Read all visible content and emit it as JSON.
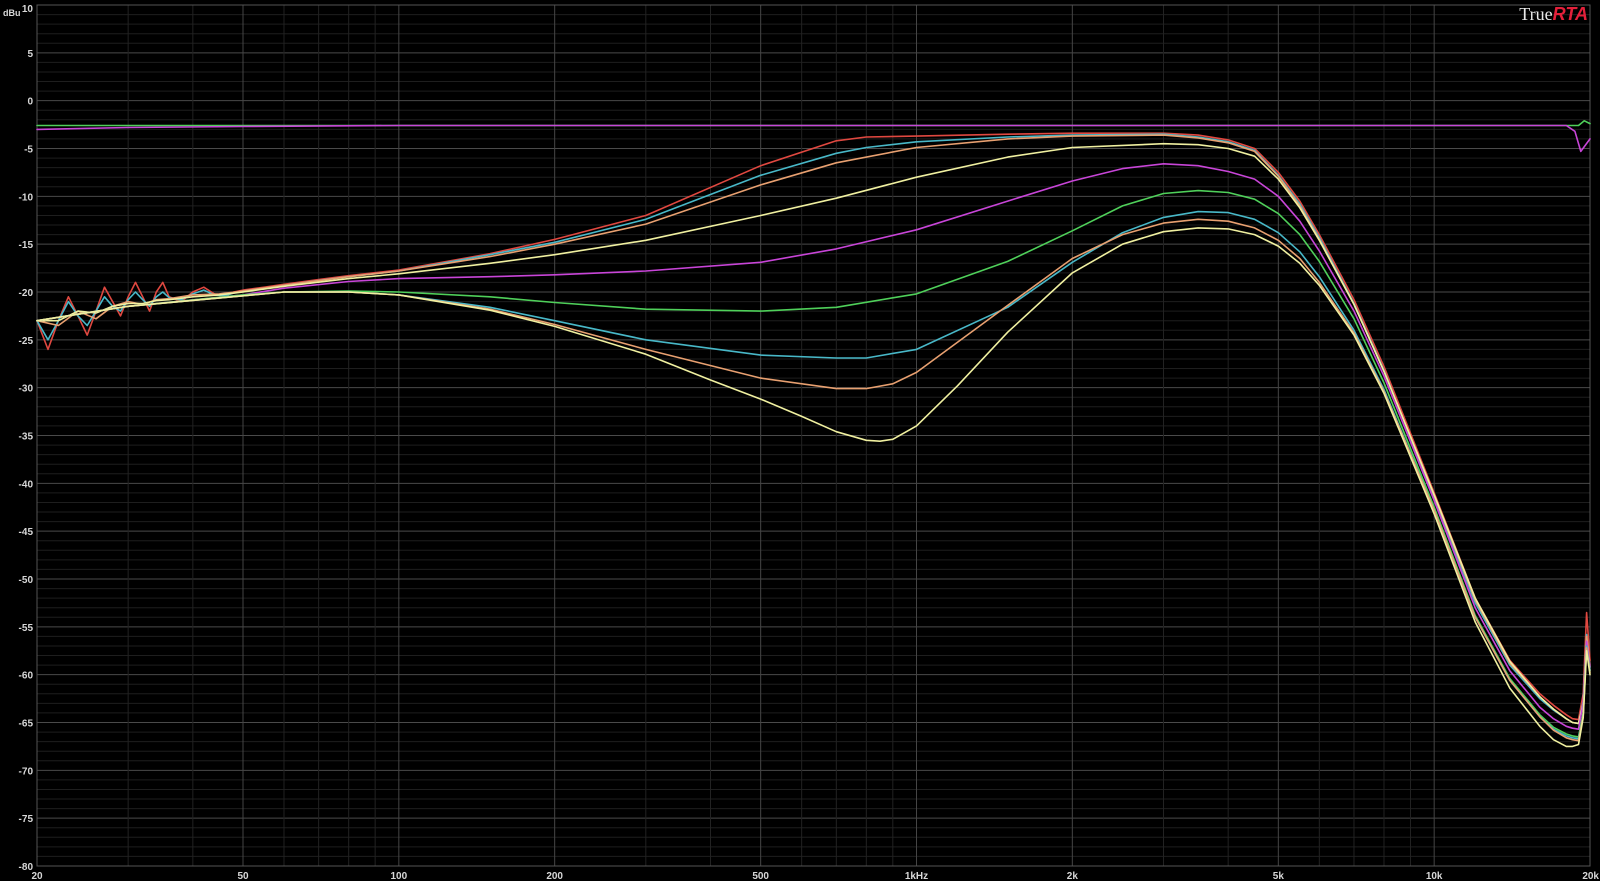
{
  "app": {
    "logo_part1": "True",
    "logo_part2": "RTA"
  },
  "chart_data": {
    "type": "line",
    "title": "",
    "xlabel": "",
    "ylabel": "dBu",
    "xscale": "log",
    "xlim": [
      20,
      20000
    ],
    "ylim": [
      -80,
      10
    ],
    "grid": true,
    "x_tick_labels": [
      {
        "x": 20,
        "label": "20"
      },
      {
        "x": 50,
        "label": "50"
      },
      {
        "x": 100,
        "label": "100"
      },
      {
        "x": 200,
        "label": "200"
      },
      {
        "x": 500,
        "label": "500"
      },
      {
        "x": 1000,
        "label": "1kHz"
      },
      {
        "x": 2000,
        "label": "2k"
      },
      {
        "x": 5000,
        "label": "5k"
      },
      {
        "x": 10000,
        "label": "10k"
      },
      {
        "x": 20000,
        "label": "20k"
      }
    ],
    "y_tick_labels": [
      {
        "y": 10,
        "label": "10"
      },
      {
        "y": 5,
        "label": "5"
      },
      {
        "y": 0,
        "label": "0"
      },
      {
        "y": -5,
        "label": "-5"
      },
      {
        "y": -10,
        "label": "-10"
      },
      {
        "y": -15,
        "label": "-15"
      },
      {
        "y": -20,
        "label": "-20"
      },
      {
        "y": -25,
        "label": "-25"
      },
      {
        "y": -30,
        "label": "-30"
      },
      {
        "y": -35,
        "label": "-35"
      },
      {
        "y": -40,
        "label": "-40"
      },
      {
        "y": -45,
        "label": "-45"
      },
      {
        "y": -50,
        "label": "-50"
      },
      {
        "y": -55,
        "label": "-55"
      },
      {
        "y": -60,
        "label": "-60"
      },
      {
        "y": -65,
        "label": "-65"
      },
      {
        "y": -70,
        "label": "-70"
      },
      {
        "y": -75,
        "label": "-75"
      },
      {
        "y": -80,
        "label": "-80"
      }
    ],
    "series": [
      {
        "color": "#4fd05a",
        "x": [
          20,
          30,
          50,
          100,
          1000,
          5000,
          10000,
          18000,
          19000,
          19500,
          20000
        ],
        "y": [
          -2.6,
          -2.6,
          -2.6,
          -2.6,
          -2.6,
          -2.6,
          -2.6,
          -2.6,
          -2.6,
          -2.1,
          -2.4
        ]
      },
      {
        "color": "#c845d8",
        "x": [
          20,
          30,
          50,
          100,
          1000,
          5000,
          10000,
          18000,
          18700,
          19200,
          20000
        ],
        "y": [
          -3.0,
          -2.8,
          -2.7,
          -2.6,
          -2.6,
          -2.6,
          -2.6,
          -2.6,
          -3.2,
          -5.3,
          -4.0
        ]
      },
      {
        "color": "#e04840",
        "x": [
          20,
          21,
          22,
          23,
          24,
          25,
          26,
          27,
          28,
          29,
          30,
          31,
          32,
          33,
          34,
          35,
          36,
          38,
          40,
          42,
          44,
          46,
          48,
          50,
          55,
          60,
          70,
          80,
          100,
          150,
          200,
          300,
          500,
          700,
          800,
          1000,
          1500,
          2000,
          3000,
          3500,
          4000,
          4500,
          5000,
          5500,
          6000,
          7000,
          8000,
          10000,
          12000,
          14000,
          16000,
          17000,
          18000,
          18500,
          19000,
          19400,
          19700,
          20000
        ],
        "y": [
          -23,
          -26,
          -23,
          -20.5,
          -22.5,
          -24.5,
          -22,
          -19.5,
          -21,
          -22.5,
          -20.5,
          -19,
          -20.5,
          -22,
          -20,
          -19,
          -20.5,
          -21,
          -20,
          -19.5,
          -20.2,
          -20.5,
          -20,
          -19.8,
          -19.5,
          -19.2,
          -18.7,
          -18.3,
          -17.7,
          -16.0,
          -14.5,
          -12.0,
          -6.8,
          -4.2,
          -3.8,
          -3.7,
          -3.5,
          -3.4,
          -3.4,
          -3.6,
          -4.1,
          -5.0,
          -7.5,
          -10.5,
          -14,
          -20.8,
          -27.8,
          -41,
          -52,
          -58.5,
          -62,
          -63.2,
          -64.2,
          -64.6,
          -64.7,
          -62,
          -53.5,
          -58.5
        ]
      },
      {
        "color": "#48b8c8",
        "x": [
          20,
          21,
          22,
          23,
          24,
          25,
          26,
          27,
          28,
          29,
          30,
          31,
          32,
          33,
          34,
          35,
          36,
          38,
          40,
          42,
          44,
          46,
          48,
          50,
          55,
          60,
          70,
          80,
          100,
          150,
          200,
          300,
          500,
          700,
          800,
          1000,
          1500,
          2000,
          3000,
          3500,
          4000,
          4500,
          5000,
          5500,
          6000,
          7000,
          8000,
          10000,
          12000,
          14000,
          16000,
          17000,
          18000,
          18500,
          19000,
          19400,
          19700,
          20000
        ],
        "y": [
          -23,
          -25,
          -23,
          -21,
          -22.5,
          -23.5,
          -22,
          -20.5,
          -21.5,
          -22,
          -20.8,
          -20,
          -20.8,
          -21.5,
          -20.5,
          -20,
          -20.6,
          -20.8,
          -20.2,
          -19.8,
          -20.3,
          -20.4,
          -20.1,
          -19.9,
          -19.6,
          -19.3,
          -18.8,
          -18.4,
          -17.8,
          -16.1,
          -14.8,
          -12.4,
          -7.8,
          -5.5,
          -4.9,
          -4.3,
          -3.8,
          -3.6,
          -3.5,
          -3.8,
          -4.3,
          -5.2,
          -7.8,
          -10.8,
          -14.3,
          -21.2,
          -28.2,
          -41.5,
          -52.5,
          -59,
          -62.5,
          -63.7,
          -64.6,
          -65.0,
          -65.1,
          -62.8,
          -55.8,
          -59.5
        ]
      },
      {
        "color": "#e8a070",
        "x": [
          20,
          22,
          24,
          26,
          28,
          30,
          32,
          34,
          36,
          40,
          45,
          50,
          60,
          80,
          100,
          150,
          200,
          300,
          500,
          700,
          1000,
          1500,
          2000,
          3000,
          3500,
          4000,
          4500,
          5000,
          5500,
          6000,
          7000,
          8000,
          10000,
          12000,
          14000,
          16000,
          17000,
          18000,
          18500,
          19000,
          19400,
          19700,
          20000
        ],
        "y": [
          -23,
          -23.5,
          -22,
          -22.8,
          -21.5,
          -21,
          -21.3,
          -20.8,
          -20.7,
          -20.3,
          -20.2,
          -19.9,
          -19.3,
          -18.4,
          -17.8,
          -16.3,
          -15.0,
          -12.9,
          -8.8,
          -6.5,
          -4.9,
          -4.0,
          -3.7,
          -3.6,
          -3.9,
          -4.4,
          -5.3,
          -7.9,
          -11,
          -14.5,
          -21.3,
          -28.3,
          -41.3,
          -52.2,
          -58.8,
          -62.3,
          -63.6,
          -64.6,
          -65,
          -65.1,
          -63,
          -56,
          -59
        ]
      },
      {
        "color": "#f0f0a0",
        "x": [
          20,
          22,
          24,
          26,
          28,
          30,
          32,
          34,
          36,
          40,
          45,
          50,
          60,
          80,
          100,
          150,
          200,
          300,
          500,
          700,
          1000,
          1500,
          2000,
          3000,
          3500,
          4000,
          4500,
          5000,
          5500,
          6000,
          7000,
          8000,
          10000,
          12000,
          14000,
          16000,
          17000,
          18000,
          18500,
          19000,
          19400,
          19700,
          20000
        ],
        "y": [
          -23,
          -23,
          -22,
          -22.2,
          -21.5,
          -21.2,
          -21.2,
          -20.9,
          -20.8,
          -20.5,
          -20.3,
          -20.0,
          -19.4,
          -18.6,
          -18.1,
          -17.0,
          -16.1,
          -14.6,
          -12.0,
          -10.2,
          -8.0,
          -5.9,
          -4.9,
          -4.5,
          -4.6,
          -5.0,
          -5.8,
          -8.2,
          -11.2,
          -14.6,
          -21.3,
          -28.3,
          -41.2,
          -52,
          -58.6,
          -62.3,
          -63.6,
          -64.6,
          -65,
          -65.1,
          -63,
          -56.5,
          -59.2
        ]
      },
      {
        "color": "#c845d8",
        "x": [
          20,
          30,
          50,
          60,
          80,
          100,
          150,
          200,
          300,
          500,
          700,
          1000,
          1500,
          2000,
          2500,
          3000,
          3500,
          4000,
          4500,
          5000,
          5500,
          6000,
          7000,
          8000,
          10000,
          12000,
          14000,
          16000,
          17000,
          18000,
          18500,
          19000,
          19400,
          19700,
          20000
        ],
        "y": [
          -23,
          -21.5,
          -20.3,
          -19.6,
          -18.9,
          -18.6,
          -18.4,
          -18.2,
          -17.8,
          -16.9,
          -15.5,
          -13.5,
          -10.5,
          -8.4,
          -7.1,
          -6.6,
          -6.8,
          -7.4,
          -8.2,
          -10.0,
          -12.6,
          -15.7,
          -22.0,
          -28.8,
          -41.8,
          -53,
          -59.6,
          -63.4,
          -64.6,
          -65.4,
          -65.6,
          -65.7,
          -63,
          -56.5,
          -59.2
        ]
      },
      {
        "color": "#4fd05a",
        "x": [
          20,
          30,
          50,
          60,
          80,
          100,
          150,
          200,
          300,
          500,
          700,
          1000,
          1500,
          2000,
          2500,
          3000,
          3500,
          4000,
          4500,
          5000,
          5500,
          6000,
          7000,
          8000,
          10000,
          12000,
          14000,
          16000,
          17000,
          18000,
          18500,
          19000,
          19400,
          19700,
          20000
        ],
        "y": [
          -23,
          -21.5,
          -20.3,
          -20.0,
          -19.9,
          -20.0,
          -20.5,
          -21.1,
          -21.8,
          -22.0,
          -21.6,
          -20.2,
          -16.8,
          -13.6,
          -11.0,
          -9.7,
          -9.4,
          -9.6,
          -10.3,
          -11.8,
          -14.0,
          -16.8,
          -22.8,
          -29.5,
          -42.5,
          -53.8,
          -60.4,
          -64.2,
          -65.5,
          -66.2,
          -66.4,
          -66.5,
          -64,
          -57,
          -59.6
        ]
      },
      {
        "color": "#48b8c8",
        "x": [
          20,
          30,
          50,
          60,
          80,
          100,
          150,
          200,
          300,
          500,
          700,
          800,
          1000,
          1500,
          2000,
          2500,
          3000,
          3500,
          4000,
          4500,
          5000,
          5500,
          6000,
          7000,
          8000,
          10000,
          12000,
          14000,
          16000,
          17000,
          18000,
          18500,
          19000,
          19400,
          19700,
          20000
        ],
        "y": [
          -23,
          -21.5,
          -20.4,
          -20.0,
          -20.0,
          -20.3,
          -21.6,
          -23.0,
          -25.0,
          -26.6,
          -26.9,
          -26.9,
          -26.0,
          -21.6,
          -16.9,
          -13.8,
          -12.2,
          -11.6,
          -11.7,
          -12.4,
          -13.8,
          -15.8,
          -18.4,
          -24.0,
          -30.2,
          -42.8,
          -54,
          -60.6,
          -64.4,
          -65.7,
          -66.4,
          -66.6,
          -66.7,
          -64.2,
          -57,
          -59.6
        ]
      },
      {
        "color": "#e8a070",
        "x": [
          20,
          30,
          50,
          60,
          80,
          100,
          150,
          200,
          300,
          500,
          700,
          800,
          900,
          1000,
          1500,
          2000,
          2500,
          3000,
          3500,
          4000,
          4500,
          5000,
          5500,
          6000,
          7000,
          8000,
          10000,
          12000,
          14000,
          16000,
          17000,
          18000,
          18500,
          19000,
          19400,
          19700,
          20000
        ],
        "y": [
          -23,
          -21.5,
          -20.4,
          -20.0,
          -20.0,
          -20.3,
          -21.8,
          -23.4,
          -26.0,
          -29.0,
          -30.1,
          -30.1,
          -29.6,
          -28.4,
          -21.4,
          -16.5,
          -14.0,
          -12.8,
          -12.4,
          -12.6,
          -13.3,
          -14.6,
          -16.5,
          -19.0,
          -24.3,
          -30.4,
          -42.8,
          -54,
          -60.6,
          -64.4,
          -65.8,
          -66.6,
          -66.8,
          -66.9,
          -64.3,
          -57.2,
          -59.8
        ]
      },
      {
        "color": "#f0f0a0",
        "x": [
          20,
          30,
          50,
          60,
          80,
          100,
          150,
          200,
          300,
          400,
          500,
          600,
          700,
          800,
          850,
          900,
          1000,
          1200,
          1500,
          2000,
          2500,
          3000,
          3500,
          4000,
          4500,
          5000,
          5500,
          6000,
          7000,
          8000,
          10000,
          12000,
          14000,
          16000,
          17000,
          18000,
          18500,
          19000,
          19400,
          19700,
          20000
        ],
        "y": [
          -23,
          -21.5,
          -20.4,
          -20.0,
          -20.0,
          -20.3,
          -21.9,
          -23.6,
          -26.5,
          -29.2,
          -31.2,
          -33.0,
          -34.6,
          -35.5,
          -35.6,
          -35.4,
          -34.0,
          -29.8,
          -24.2,
          -18.0,
          -15.0,
          -13.7,
          -13.3,
          -13.4,
          -14.0,
          -15.2,
          -17.0,
          -19.3,
          -24.5,
          -30.6,
          -43.2,
          -54.5,
          -61.4,
          -65.4,
          -66.8,
          -67.5,
          -67.5,
          -67.3,
          -64.5,
          -57.5,
          -60
        ]
      }
    ]
  }
}
